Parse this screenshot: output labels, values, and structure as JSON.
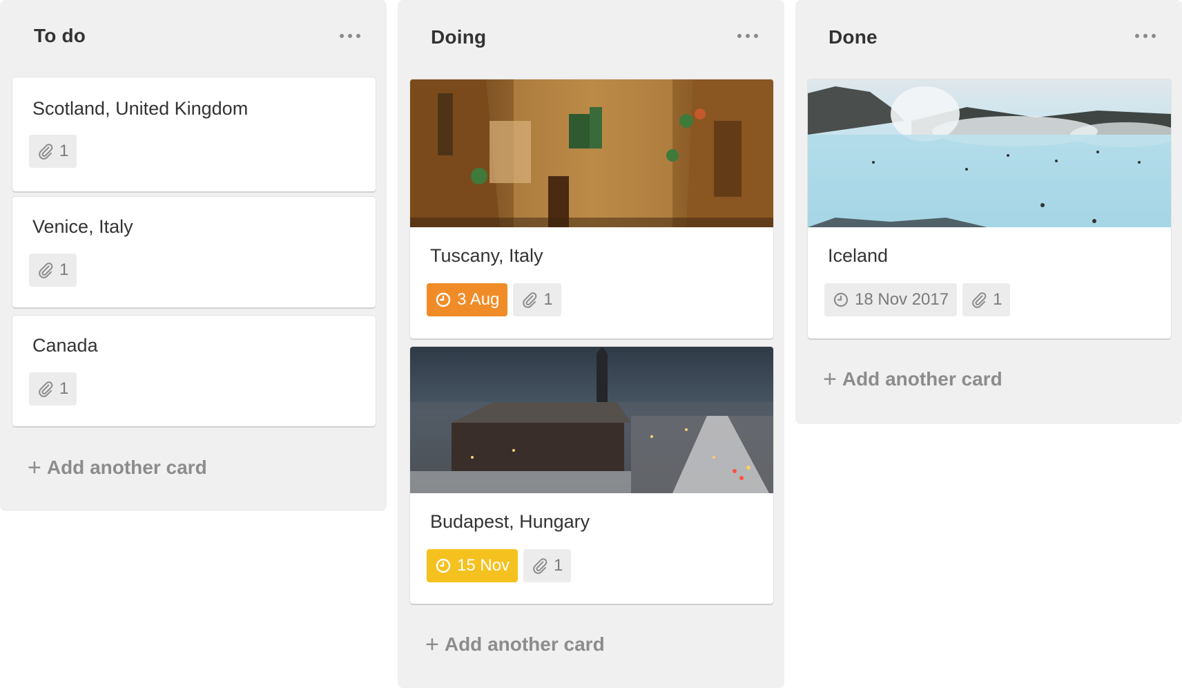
{
  "lists": [
    {
      "title": "To do",
      "add_card_label": "Add another card",
      "cards": [
        {
          "title": "Scotland, United Kingdom",
          "attachments": "1"
        },
        {
          "title": "Venice, Italy",
          "attachments": "1"
        },
        {
          "title": "Canada",
          "attachments": "1"
        }
      ]
    },
    {
      "title": "Doing",
      "add_card_label": "Add another card",
      "cards": [
        {
          "title": "Tuscany, Italy",
          "due": "3 Aug",
          "due_color": "#f08c28",
          "attachments": "1",
          "cover": "narrow-stone-street-photo"
        },
        {
          "title": "Budapest, Hungary",
          "due": "15 Nov",
          "due_color": "#f5c11f",
          "attachments": "1",
          "cover": "snowy-city-night-photo"
        }
      ]
    },
    {
      "title": "Done",
      "add_card_label": "Add another card",
      "cards": [
        {
          "title": "Iceland",
          "due": "18 Nov 2017",
          "due_color": "#ececec",
          "attachments": "1",
          "cover": "geothermal-lagoon-photo"
        }
      ]
    }
  ],
  "icons": {
    "list_menu": "ellipsis-icon",
    "attachment": "paperclip-icon",
    "due": "clock-icon",
    "add": "plus-icon"
  },
  "colors": {
    "list_bg": "#f0f0f0",
    "due_orange": "#f08c28",
    "due_yellow": "#f5c11f",
    "badge_grey": "#ececec"
  }
}
